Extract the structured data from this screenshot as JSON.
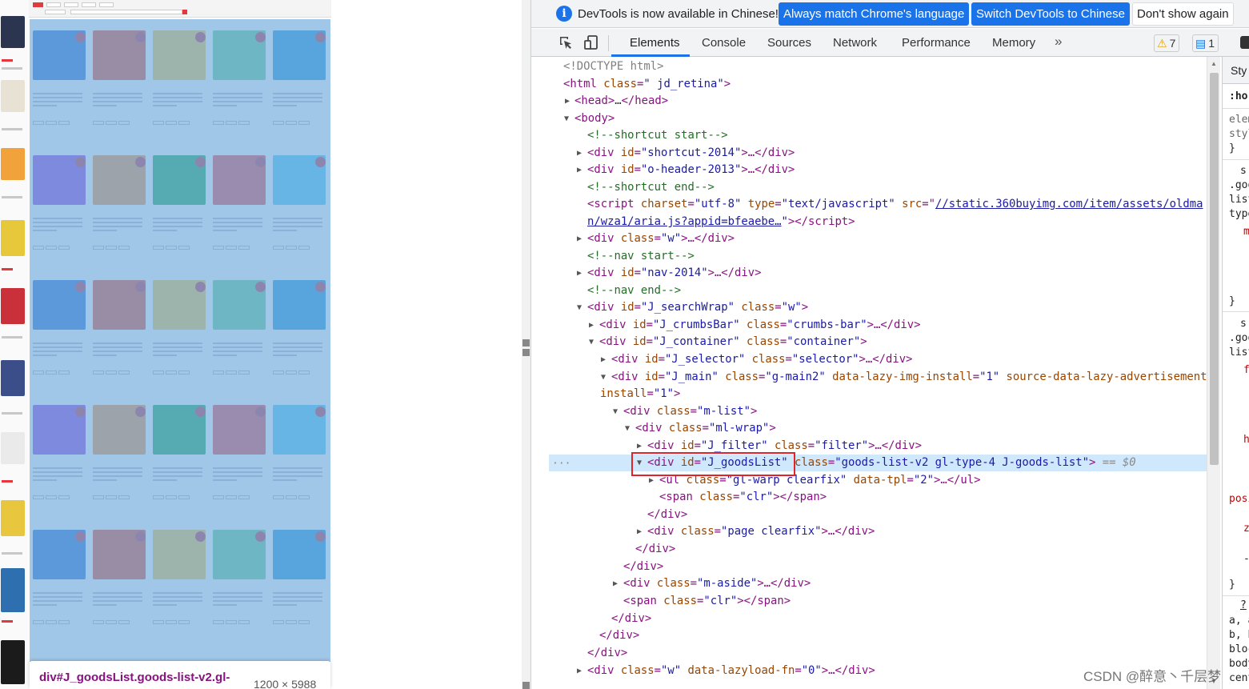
{
  "page_preview": {
    "tooltip_selector": "div#J_goodsList.goods-list-v2.gl-",
    "tooltip_size": "1200 × 5988"
  },
  "devtools": {
    "infobar": {
      "message": "DevTools is now available in Chinese!",
      "btn_match": "Always match Chrome's language",
      "btn_switch": "Switch DevTools to Chinese",
      "btn_dismiss": "Don't show again"
    },
    "tabs": [
      "Elements",
      "Console",
      "Sources",
      "Network",
      "Performance",
      "Memory"
    ],
    "more_tabs": "»",
    "warnings_count": "7",
    "messages_count": "1",
    "selected_suffix": "== $0",
    "dots": "···"
  },
  "styles_pane": {
    "lines": [
      "Sty",
      ":ho",
      "elem",
      "styl",
      "}",
      "s",
      ".goo",
      "list",
      "type",
      "m",
      "}",
      "s",
      ".goo",
      "list",
      "f",
      "h",
      "posi",
      "z",
      "-",
      "}",
      "?",
      "a, a",
      "b, b",
      "bloc",
      "body",
      "cent"
    ]
  },
  "watermark": "CSDN @醉意丶千层梦",
  "code": {
    "l01": "<!DOCTYPE html>",
    "l02_tag": "html",
    "l02_attr": "class",
    "l02_val": "\" jd_retina\"",
    "l03_open": "<head>",
    "l03_ell": "…",
    "l03_close": "</head>",
    "l04": "<body>",
    "l05": "<!--shortcut start-->",
    "l06_attr": "id",
    "l06_val": "\"shortcut-2014\"",
    "l07_attr": "id",
    "l07_val": "\"o-header-2013\"",
    "l08": "<!--shortcut end-->",
    "l09_a1": "charset",
    "l09_v1": "\"utf-8\"",
    "l09_a2": "type",
    "l09_v2": "\"text/javascript\"",
    "l09_a3": "src",
    "l09_link": "//static.360buyimg.com/item/assets/oldma",
    "l10_link": "n/wza1/aria.js?appid=bfeaebe…",
    "l11_attr": "class",
    "l11_val": "\"w\"",
    "l12": "<!--nav start-->",
    "l13_attr": "id",
    "l13_val": "\"nav-2014\"",
    "l14": "<!--nav end-->",
    "l15_a1": "id",
    "l15_v1": "\"J_searchWrap\"",
    "l15_a2": "class",
    "l15_v2": "\"w\"",
    "l16_a1": "id",
    "l16_v1": "\"J_crumbsBar\"",
    "l16_a2": "class",
    "l16_v2": "\"crumbs-bar\"",
    "l17_a1": "id",
    "l17_v1": "\"J_container\"",
    "l17_a2": "class",
    "l17_v2": "\"container\"",
    "l18_a1": "id",
    "l18_v1": "\"J_selector\"",
    "l18_a2": "class",
    "l18_v2": "\"selector\"",
    "l19_a1": "id",
    "l19_v1": "\"J_main\"",
    "l19_a2": "class",
    "l19_v2": "\"g-main2\"",
    "l19_a3": "data-lazy-img-install",
    "l19_v3": "\"1\"",
    "l19_a4": "source-data-lazy-advertisement-",
    "l20_a": "install",
    "l20_v": "\"1\"",
    "l21_attr": "class",
    "l21_val": "\"m-list\"",
    "l22_attr": "class",
    "l22_val": "\"ml-wrap\"",
    "l23_a1": "id",
    "l23_v1": "\"J_filter\"",
    "l23_a2": "class",
    "l23_v2": "\"filter\"",
    "l24_a1": "id",
    "l24_v1": "\"J_goodsList\"",
    "l24_a2": "class",
    "l24_v2": "\"goods-list-v2 gl-type-4 J-goods-list\"",
    "l25_a1": "class",
    "l25_v1": "\"gl-warp clearfix\"",
    "l25_a2": "data-tpl",
    "l25_v2": "\"2\"",
    "l26_attr": "class",
    "l26_val": "\"clr\"",
    "l27": "</div>",
    "l28_attr": "class",
    "l28_val": "\"page clearfix\"",
    "l29": "</div>",
    "l30": "</div>",
    "l31_attr": "class",
    "l31_val": "\"m-aside\"",
    "l32_attr": "class",
    "l32_val": "\"clr\"",
    "l33": "</div>",
    "l34": "</div>",
    "l35": "</div>",
    "l36_a1": "class",
    "l36_v1": "\"w\"",
    "l36_a2": "data-lazyload-fn",
    "l36_v2": "\"0\""
  },
  "colors": {
    "accent": "#1a73e8",
    "tag": "#881280",
    "attr_name": "#994500",
    "attr_value": "#1a1aa6",
    "comment": "#236e25",
    "selection": "#cfe8fc",
    "highlight_box": "#e0242a",
    "overlay": "#6fa8dc"
  }
}
